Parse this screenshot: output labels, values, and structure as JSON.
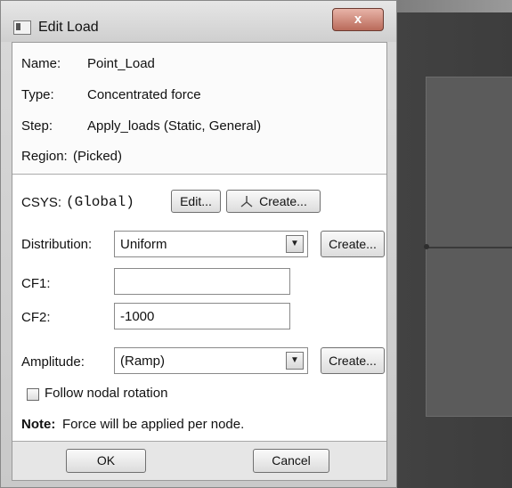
{
  "window": {
    "title": "Edit Load",
    "close_label": "x"
  },
  "info": {
    "name_label": "Name:",
    "name_value": "Point_Load",
    "type_label": "Type:",
    "type_value": "Concentrated force",
    "step_label": "Step:",
    "step_value": "Apply_loads (Static, General)",
    "region_label": "Region:",
    "region_value": "(Picked)"
  },
  "csys": {
    "label": "CSYS:",
    "value": "(Global)",
    "edit_label": "Edit...",
    "create_label": "Create..."
  },
  "distribution": {
    "label": "Distribution:",
    "selected": "Uniform",
    "create_label": "Create..."
  },
  "cf1": {
    "label": "CF1:",
    "value": ""
  },
  "cf2": {
    "label": "CF2:",
    "value": "-1000"
  },
  "amplitude": {
    "label": "Amplitude:",
    "selected": "(Ramp)",
    "create_label": "Create..."
  },
  "follow_nodal": {
    "label": "Follow nodal rotation",
    "checked": false
  },
  "note": {
    "prefix": "Note:",
    "text": "Force will be applied per node."
  },
  "buttons": {
    "ok_label": "OK",
    "cancel_label": "Cancel"
  },
  "icons": {
    "combo_arrow": "chevron-down-icon",
    "csys_create": "triad-icon",
    "window": "window-icon"
  }
}
